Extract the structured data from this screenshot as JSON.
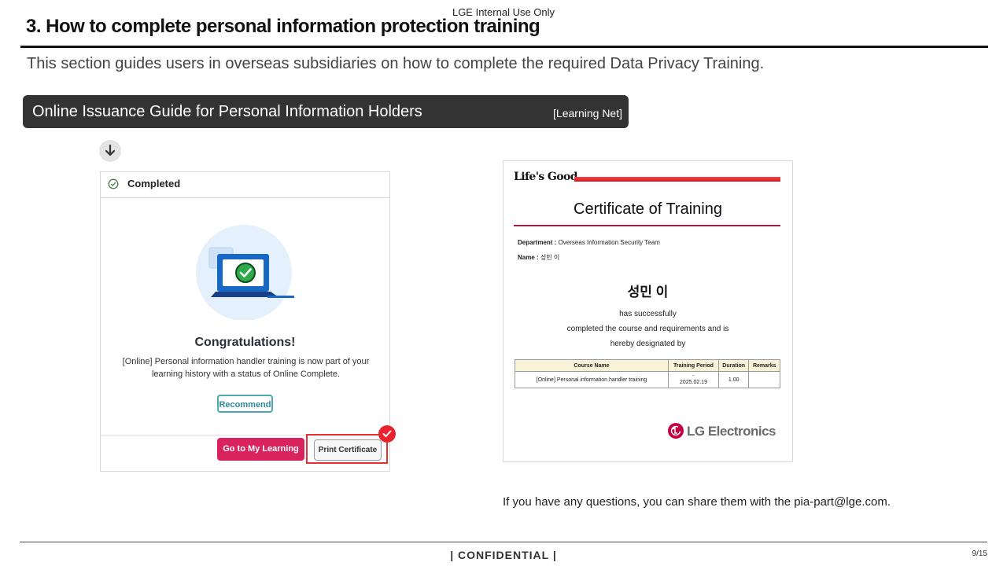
{
  "header": {
    "top_label": "LGE Internal Use Only",
    "title": "3. How to complete personal information protection training",
    "subtitle": "This section guides users in overseas subsidiaries on how to complete the required Data Privacy Training."
  },
  "guide_banner": {
    "title": "Online Issuance Guide for Personal Information Holders",
    "tag": "[Learning Net]"
  },
  "icons": {
    "step_arrow": "arrow-down-icon",
    "completed": "check-circle-icon",
    "illustration": "laptop-check-icon",
    "badge": "check-badge-icon",
    "lg_logo": "lg-logo-icon"
  },
  "lms_panel": {
    "status_label": "Completed",
    "heading": "Congratulations!",
    "message": "[Online] Personal information handler training is now part of your learning history with a status of Online Complete.",
    "recommend_label": "Recommend",
    "goto_label": "Go to My Learning",
    "print_label": "Print Certificate"
  },
  "certificate": {
    "brand": "Life's Good.",
    "title": "Certificate of Training",
    "department_label": "Department :",
    "department_value": "Overseas Information Security Team",
    "name_label": "Name :",
    "name_value": "성민 이",
    "recipient": "성민 이",
    "line1": "has successfully",
    "line2": "completed the course and requirements and is",
    "line3": "hereby designated by",
    "table": {
      "headers": [
        "Course Name",
        "Training Period",
        "Duration",
        "Remarks"
      ],
      "row": {
        "course": "[Online] Personal information handler training",
        "period_top": "-",
        "period_date": "2025.02.19",
        "duration": "1.00",
        "remarks": ""
      }
    },
    "company": "LG Electronics"
  },
  "contact_text": "If you have any questions, you can share them with the pia-part@lge.com.",
  "footer": {
    "confidential": "| CONFIDENTIAL |",
    "page": "9/15"
  },
  "colors": {
    "banner_bg": "#333333",
    "goto_button": "#d9235d",
    "highlight_red": "#e53030",
    "recommend_teal": "#4aa9b3",
    "cert_rule": "#a71940",
    "lg_red": "#c5003e"
  }
}
